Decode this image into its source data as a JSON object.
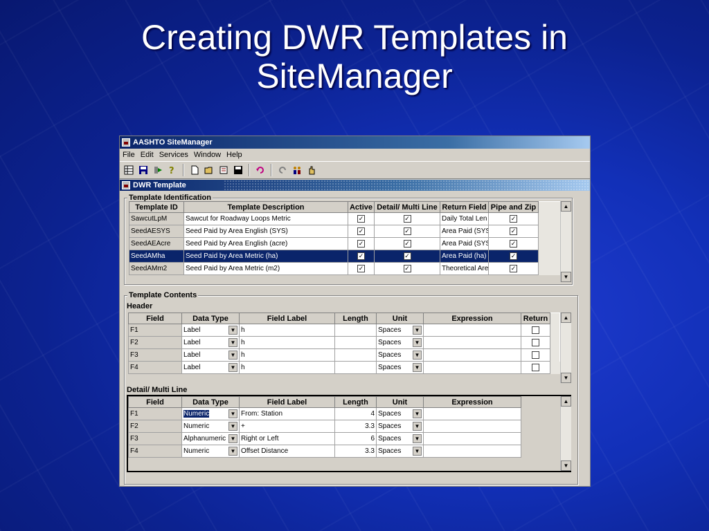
{
  "slide": {
    "title_line1": "Creating DWR Templates in",
    "title_line2": "SiteManager"
  },
  "window": {
    "title": "AASHTO SiteManager"
  },
  "menu": [
    "File",
    "Edit",
    "Services",
    "Window",
    "Help"
  ],
  "toolbar_icons": [
    "grid-icon",
    "save-disk-icon",
    "arrow-icon",
    "help-icon",
    "new-document-icon",
    "open-folder-icon",
    "wizard-icon",
    "save-icon",
    "undo-icon",
    "redo-icon",
    "people-icon",
    "hand-icon"
  ],
  "child": {
    "title": "DWR Template"
  },
  "identification": {
    "legend": "Template Identification",
    "headers": [
      "Template ID",
      "Template Description",
      "Active",
      "Detail/ Multi Line",
      "Return Field",
      "Pipe and Zip"
    ],
    "rows": [
      {
        "id": "SawcutLpM",
        "desc": "Sawcut for Roadway Loops Metric",
        "active": true,
        "detail": true,
        "return_field": "Daily Total Len",
        "pipe": true,
        "selected": false
      },
      {
        "id": "SeedAESYS",
        "desc": "Seed Paid by Area English (SYS)",
        "active": true,
        "detail": true,
        "return_field": "Area Paid (SYS",
        "pipe": true,
        "selected": false
      },
      {
        "id": "SeedAEAcre",
        "desc": "Seed Paid by Area English (acre)",
        "active": true,
        "detail": true,
        "return_field": "Area Paid (SYS",
        "pipe": true,
        "selected": false
      },
      {
        "id": "SeedAMha",
        "desc": "Seed Paid by Area Metric (ha)",
        "active": true,
        "detail": true,
        "return_field": "Area Paid (ha)",
        "pipe": true,
        "selected": true
      },
      {
        "id": "SeedAMm2",
        "desc": "Seed Paid by Area Metric (m2)",
        "active": true,
        "detail": true,
        "return_field": "Theoretical Are",
        "pipe": true,
        "selected": false
      }
    ]
  },
  "contents": {
    "legend": "Template Contents",
    "header_label": "Header",
    "header_columns": [
      "Field",
      "Data Type",
      "Field Label",
      "Length",
      "Unit",
      "Expression",
      "Return"
    ],
    "header_rows": [
      {
        "field": "F1",
        "type": "Label",
        "label": "h",
        "length": "",
        "unit": "Spaces",
        "expression": "",
        "return": false
      },
      {
        "field": "F2",
        "type": "Label",
        "label": "h",
        "length": "",
        "unit": "Spaces",
        "expression": "",
        "return": false
      },
      {
        "field": "F3",
        "type": "Label",
        "label": "h",
        "length": "",
        "unit": "Spaces",
        "expression": "",
        "return": false
      },
      {
        "field": "F4",
        "type": "Label",
        "label": "h",
        "length": "",
        "unit": "Spaces",
        "expression": "",
        "return": false
      }
    ],
    "detail_label": "Detail/ Multi Line",
    "detail_columns": [
      "Field",
      "Data Type",
      "Field Label",
      "Length",
      "Unit",
      "Expression"
    ],
    "detail_rows": [
      {
        "field": "F1",
        "type": "Numeric",
        "label": "From:  Station",
        "length": "4",
        "unit": "Spaces",
        "expression": ""
      },
      {
        "field": "F2",
        "type": "Numeric",
        "label": "+",
        "length": "3.3",
        "unit": "Spaces",
        "expression": ""
      },
      {
        "field": "F3",
        "type": "Alphanumeric",
        "label": "Right or Left",
        "length": "6",
        "unit": "Spaces",
        "expression": ""
      },
      {
        "field": "F4",
        "type": "Numeric",
        "label": "Offset Distance",
        "length": "3.3",
        "unit": "Spaces",
        "expression": ""
      }
    ]
  },
  "glyphs": {
    "check": "✓",
    "dropdown": "▼",
    "up": "▲",
    "down": "▼"
  }
}
